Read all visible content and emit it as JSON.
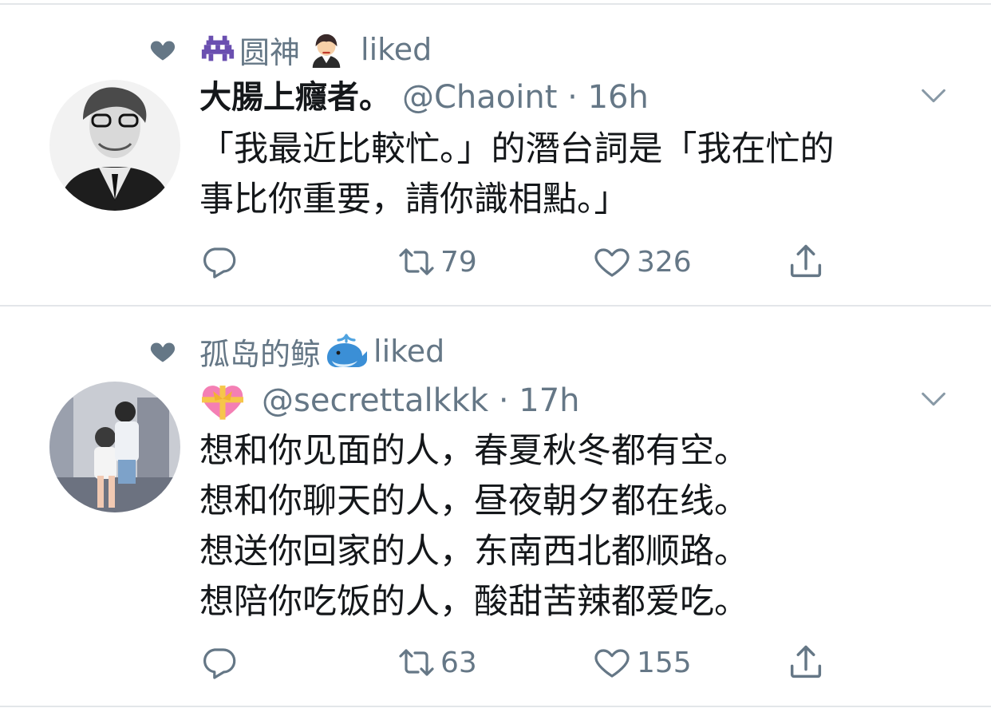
{
  "tweets": [
    {
      "social_context": {
        "user": "圆神",
        "action": "liked"
      },
      "author": {
        "name": "大腸上癮者。",
        "handle": "@Chaoint",
        "time": "16h"
      },
      "lines": [
        "「我最近比較忙。」的潛台詞是「我在忙的",
        "事比你重要，請你識相點。」"
      ],
      "stats": {
        "retweets": "79",
        "likes": "326"
      }
    },
    {
      "social_context": {
        "user": "孤岛的鲸",
        "action": "liked"
      },
      "author": {
        "name": "",
        "handle": "@secrettalkkk",
        "time": "17h"
      },
      "lines": [
        "想和你见面的人，春夏秋冬都有空。",
        "想和你聊天的人，昼夜朝夕都在线。",
        "想送你回家的人，东南西北都顺路。",
        "想陪你吃饭的人，酸甜苦辣都爱吃。"
      ],
      "stats": {
        "retweets": "63",
        "likes": "155"
      }
    }
  ],
  "colors": {
    "text": "#14171a",
    "secondary": "#657786",
    "divider": "#e3e6e9"
  },
  "icons": [
    "heart-filled-icon",
    "reply-icon",
    "retweet-icon",
    "like-icon",
    "share-icon",
    "caret-down-icon"
  ]
}
